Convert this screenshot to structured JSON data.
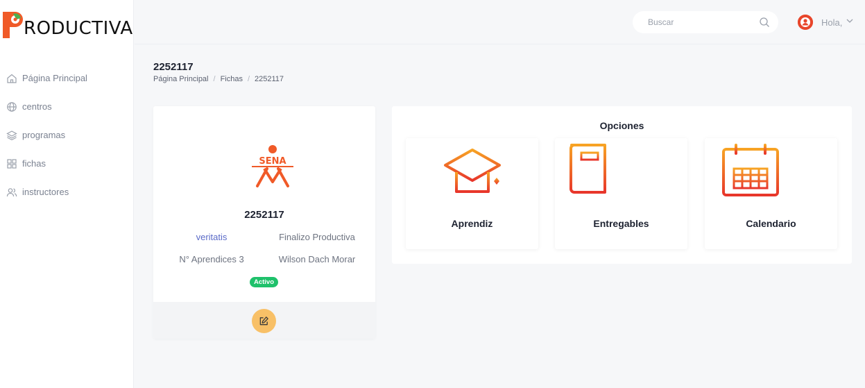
{
  "app": {
    "logo_text": "RODUCTIVA"
  },
  "sidebar": {
    "items": [
      {
        "label": "Página Principal",
        "icon": "home-icon"
      },
      {
        "label": "centros",
        "icon": "globe-icon"
      },
      {
        "label": "programas",
        "icon": "layers-icon"
      },
      {
        "label": "fichas",
        "icon": "grid-icon"
      },
      {
        "label": "instructores",
        "icon": "users-icon"
      }
    ]
  },
  "header": {
    "search_placeholder": "Buscar",
    "greeting": "Hola,"
  },
  "page": {
    "title": "2252117",
    "breadcrumb": [
      "Página Principal",
      "Fichas",
      "2252117"
    ]
  },
  "ficha_card": {
    "logo_text": "SENA",
    "title": "2252117",
    "program_link": "veritatis",
    "status_text": "Finalizo Productiva",
    "apprentices": "N° Aprendices 3",
    "instructor": "Wilson Dach Morar",
    "badge": "Activo"
  },
  "options": {
    "heading": "Opciones",
    "items": [
      {
        "label": "Aprendiz",
        "icon": "graduation-cap-icon"
      },
      {
        "label": "Entregables",
        "icon": "book-icon"
      },
      {
        "label": "Calendario",
        "icon": "calendar-icon"
      }
    ]
  },
  "colors": {
    "brand_orange": "#f05a28",
    "gradient_top": "#f7a324",
    "gradient_bottom": "#e8362b",
    "active_badge": "#1fc16b",
    "edit_button": "#f8c067",
    "link": "#5b6bc8"
  }
}
